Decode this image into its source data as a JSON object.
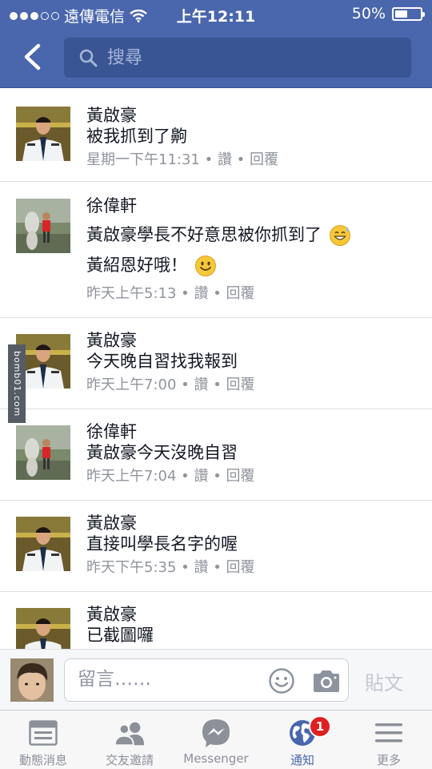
{
  "status_bar": {
    "carrier": "遠傳電信",
    "time": "上午12:11",
    "battery": "50%",
    "battery_level": 0.5,
    "signal_bars": 3
  },
  "header": {
    "back_icon": "chevron-left-icon",
    "search_placeholder": "搜尋",
    "search_icon": "search-icon",
    "color": "#4a67ad"
  },
  "comments": [
    {
      "name": "黃啟豪",
      "lines": [
        "被我抓到了齁"
      ],
      "time": "星期一下午11:31",
      "like": "讚",
      "reply": "回覆",
      "sep": " • ",
      "avatar": "uniform-avatar"
    },
    {
      "name": "徐偉軒",
      "lines": [
        "黃啟豪學長不好意思被你抓到了",
        "黃紹恩好哦！"
      ],
      "emojis": [
        "sweat-smile-emoji",
        "smile-emoji"
      ],
      "time": "昨天上午5:13",
      "like": "讚",
      "reply": "回覆",
      "sep": " • ",
      "avatar": "outdoor-avatar"
    },
    {
      "name": "黃啟豪",
      "lines": [
        "今天晚自習找我報到"
      ],
      "time": "昨天上午7:00",
      "like": "讚",
      "reply": "回覆",
      "sep": " • ",
      "avatar": "uniform-avatar"
    },
    {
      "name": "徐偉軒",
      "lines": [
        "黃啟豪今天沒晚自習"
      ],
      "time": "昨天上午7:04",
      "like": "讚",
      "reply": "回覆",
      "sep": " • ",
      "avatar": "outdoor-avatar"
    },
    {
      "name": "黃啟豪",
      "lines": [
        "直接叫學長名字的喔"
      ],
      "time": "昨天下午5:35",
      "like": "讚",
      "reply": "回覆",
      "sep": " • ",
      "avatar": "uniform-avatar"
    },
    {
      "name": "黃啟豪",
      "lines": [
        "已截圖囉"
      ],
      "time": "",
      "like": "",
      "reply": "",
      "sep": "",
      "avatar": "uniform-avatar"
    }
  ],
  "watermark": "bomb01.com",
  "composer": {
    "placeholder": "留言……",
    "post_label": "貼文",
    "emoji_icon": "smiley-icon",
    "camera_icon": "camera-icon"
  },
  "tabbar": {
    "tabs": [
      {
        "label": "動態消息",
        "icon": "news-feed-icon"
      },
      {
        "label": "交友邀請",
        "icon": "friend-requests-icon"
      },
      {
        "label": "Messenger",
        "icon": "messenger-icon"
      },
      {
        "label": "通知",
        "icon": "notifications-globe-icon",
        "badge": "1",
        "active": true
      },
      {
        "label": "更多",
        "icon": "menu-icon"
      }
    ],
    "active_color": "#4a67ad"
  }
}
